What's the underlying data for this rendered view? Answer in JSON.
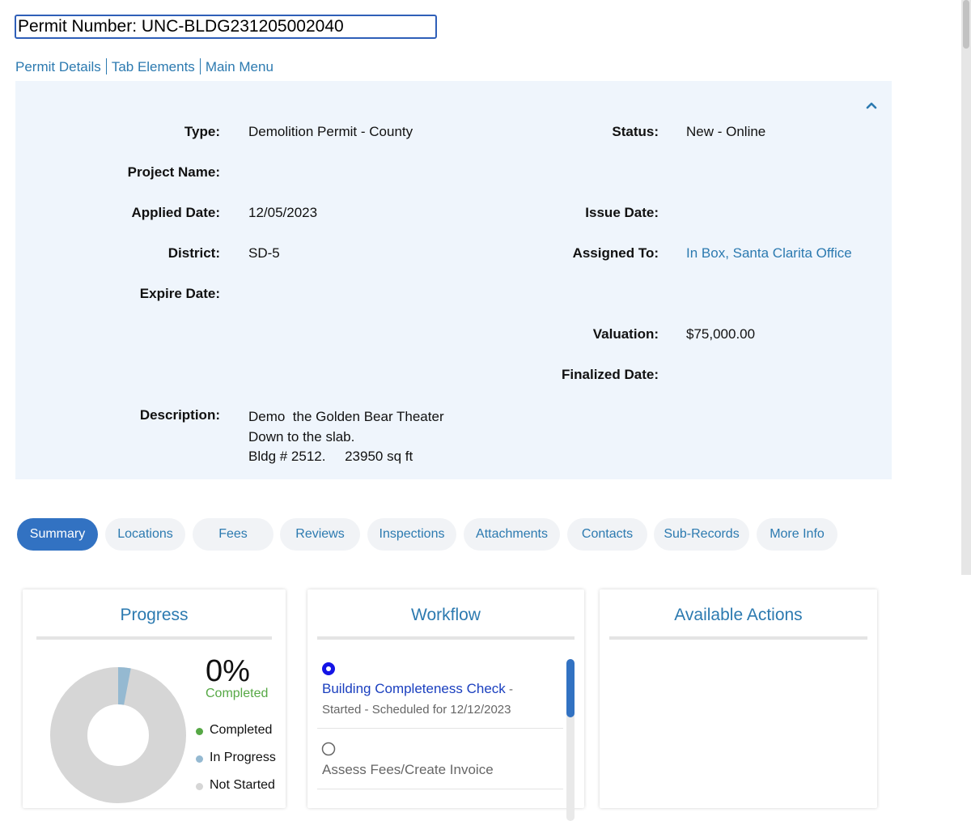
{
  "header": {
    "permit_number": "Permit Number: UNC-BLDG231205002040"
  },
  "nav": {
    "links": [
      "Permit Details",
      "Tab Elements",
      "Main Menu"
    ]
  },
  "details": {
    "type_label": "Type:",
    "type_value": "Demolition Permit - County",
    "status_label": "Status:",
    "status_value": "New - Online",
    "project_name_label": "Project Name:",
    "applied_date_label": "Applied Date:",
    "applied_date_value": "12/05/2023",
    "issue_date_label": "Issue Date:",
    "district_label": "District:",
    "district_value": "SD-5",
    "assigned_to_label": "Assigned To:",
    "assigned_to_value": "In Box, Santa Clarita Office",
    "expire_date_label": "Expire Date:",
    "valuation_label": "Valuation:",
    "valuation_value": "$75,000.00",
    "finalized_date_label": "Finalized Date:",
    "description_label": "Description:",
    "description_value": "Demo  the Golden Bear Theater\nDown to the slab.\nBldg # 2512.     23950 sq ft"
  },
  "tabs": [
    "Summary",
    "Locations",
    "Fees",
    "Reviews",
    "Inspections",
    "Attachments",
    "Contacts",
    "Sub-Records",
    "More Info"
  ],
  "active_tab": "Summary",
  "progress": {
    "title": "Progress",
    "percent": "0%",
    "completed_label": "Completed",
    "in_progress_fraction": 0.03,
    "legend": [
      {
        "label": "Completed",
        "color": "#56a845"
      },
      {
        "label": "In Progress",
        "color": "#95b9d1"
      },
      {
        "label": "Not Started",
        "color": "#d6d6d6"
      }
    ]
  },
  "workflow": {
    "title": "Workflow",
    "items": [
      {
        "title": "Building Completeness Check",
        "dash": " -",
        "sub": "Started - Scheduled for 12/12/2023",
        "selected": true
      },
      {
        "title": "Assess Fees/Create Invoice",
        "selected": false
      }
    ]
  },
  "actions": {
    "title": "Available Actions"
  },
  "colors": {
    "accent": "#2c7ab0",
    "active_tab": "#3272c2",
    "panel_bg": "#eff5fc",
    "workflow_link": "#1a3fbf"
  }
}
